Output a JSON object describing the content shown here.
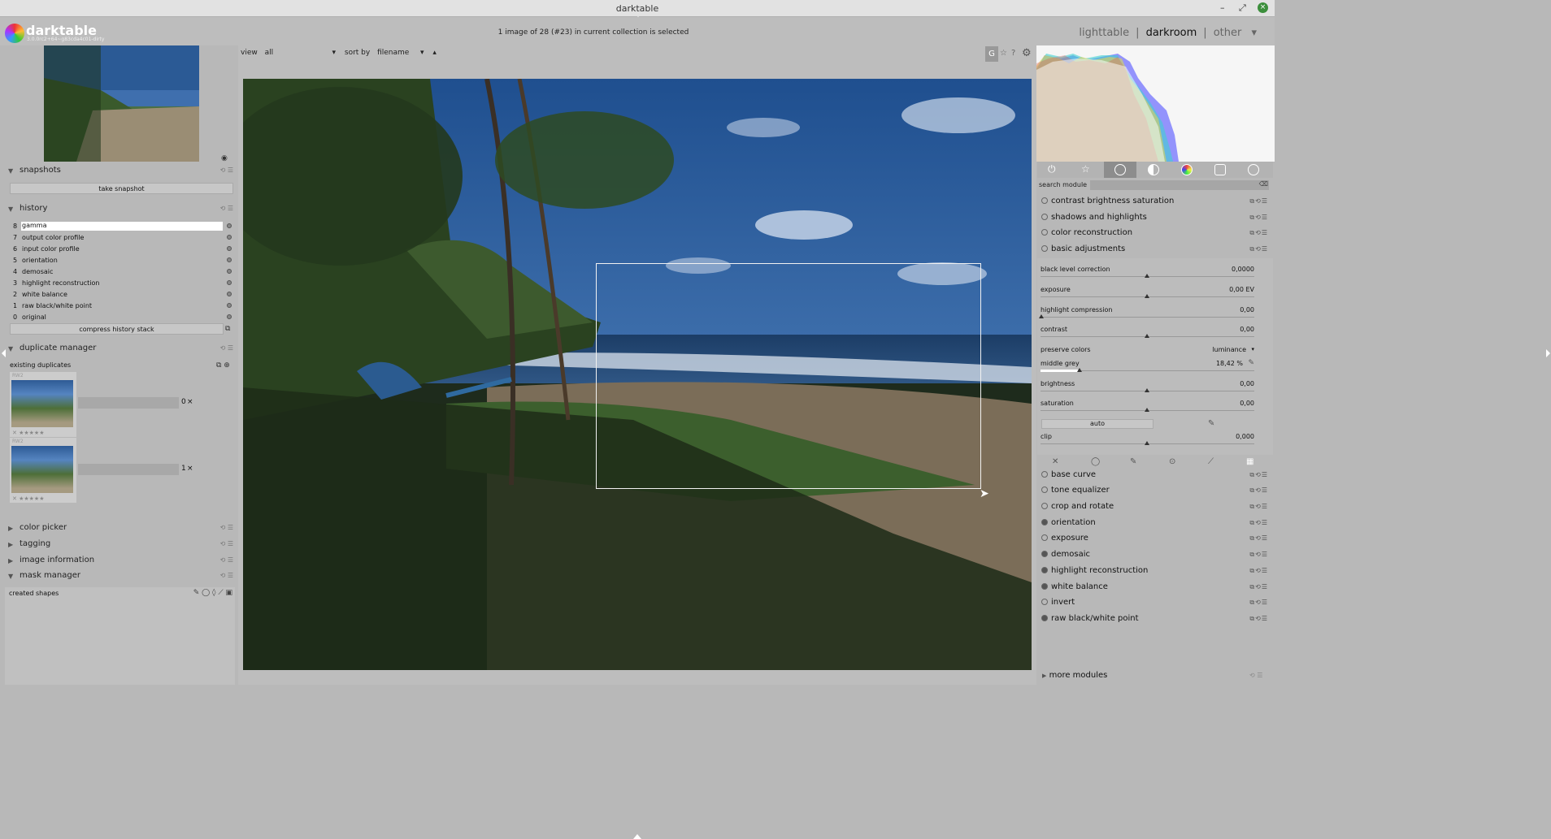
{
  "window": {
    "title": "darktable",
    "minimize": "–",
    "maximize": "⤢",
    "close": "×"
  },
  "app": {
    "name": "darktable",
    "version": "3.0.0rc2+64~g83cda4c01-dirty"
  },
  "status": "1 image of 28 (#23) in current collection is selected",
  "views": {
    "lighttable": "lighttable",
    "darkroom": "darkroom",
    "other": "other",
    "sep": "|"
  },
  "center_toolbar": {
    "view_label": "view",
    "view_value": "all",
    "sort_label": "sort by",
    "sort_value": "filename"
  },
  "left": {
    "snapshots": {
      "title": "snapshots",
      "take_snapshot": "take snapshot"
    },
    "history": {
      "title": "history",
      "items": [
        {
          "n": "8",
          "label": "gamma"
        },
        {
          "n": "7",
          "label": "output color profile"
        },
        {
          "n": "6",
          "label": "input color profile"
        },
        {
          "n": "5",
          "label": "orientation"
        },
        {
          "n": "4",
          "label": "demosaic"
        },
        {
          "n": "3",
          "label": "highlight reconstruction"
        },
        {
          "n": "2",
          "label": "white balance"
        },
        {
          "n": "1",
          "label": "raw black/white point"
        },
        {
          "n": "0",
          "label": "original"
        }
      ],
      "compress": "compress history stack"
    },
    "duplicate_manager": {
      "title": "duplicate manager",
      "existing": "existing duplicates",
      "dup1_num": "0",
      "dup2_num": "1",
      "dup_x": "×",
      "badge1": "RW2",
      "badge2": "RW2"
    },
    "color_picker": "color picker",
    "tagging": "tagging",
    "image_information": "image information",
    "mask_manager": {
      "title": "mask manager",
      "created": "created shapes"
    }
  },
  "right": {
    "search": {
      "label": "search module"
    },
    "modules_top": [
      {
        "label": "contrast brightness saturation",
        "on": false
      },
      {
        "label": "shadows and highlights",
        "on": false
      },
      {
        "label": "color reconstruction",
        "on": false
      },
      {
        "label": "basic adjustments",
        "on": false
      }
    ],
    "basic": {
      "black_level": {
        "label": "black level correction",
        "value": "0,0000"
      },
      "exposure": {
        "label": "exposure",
        "value": "0,00 EV"
      },
      "highlight": {
        "label": "highlight compression",
        "value": "0,00"
      },
      "contrast": {
        "label": "contrast",
        "value": "0,00"
      },
      "preserve": {
        "label": "preserve colors",
        "value": "luminance"
      },
      "middle_grey": {
        "label": "middle grey",
        "value": "18,42 %"
      },
      "brightness": {
        "label": "brightness",
        "value": "0,00"
      },
      "saturation": {
        "label": "saturation",
        "value": "0,00"
      },
      "auto": "auto",
      "clip": {
        "label": "clip",
        "value": "0,000"
      }
    },
    "modules_bottom": [
      {
        "label": "base curve",
        "on": false
      },
      {
        "label": "tone equalizer",
        "on": false
      },
      {
        "label": "crop and rotate",
        "on": false
      },
      {
        "label": "orientation",
        "on": true
      },
      {
        "label": "exposure",
        "on": false
      },
      {
        "label": "demosaic",
        "on": true
      },
      {
        "label": "highlight reconstruction",
        "on": true
      },
      {
        "label": "white balance",
        "on": true
      },
      {
        "label": "invert",
        "on": false
      },
      {
        "label": "raw black/white point",
        "on": true
      }
    ],
    "more_modules": "more modules"
  },
  "colors": {
    "panel": "#b8b8b8",
    "titlebar": "#e2e2e2",
    "selection": "#ffffff"
  }
}
